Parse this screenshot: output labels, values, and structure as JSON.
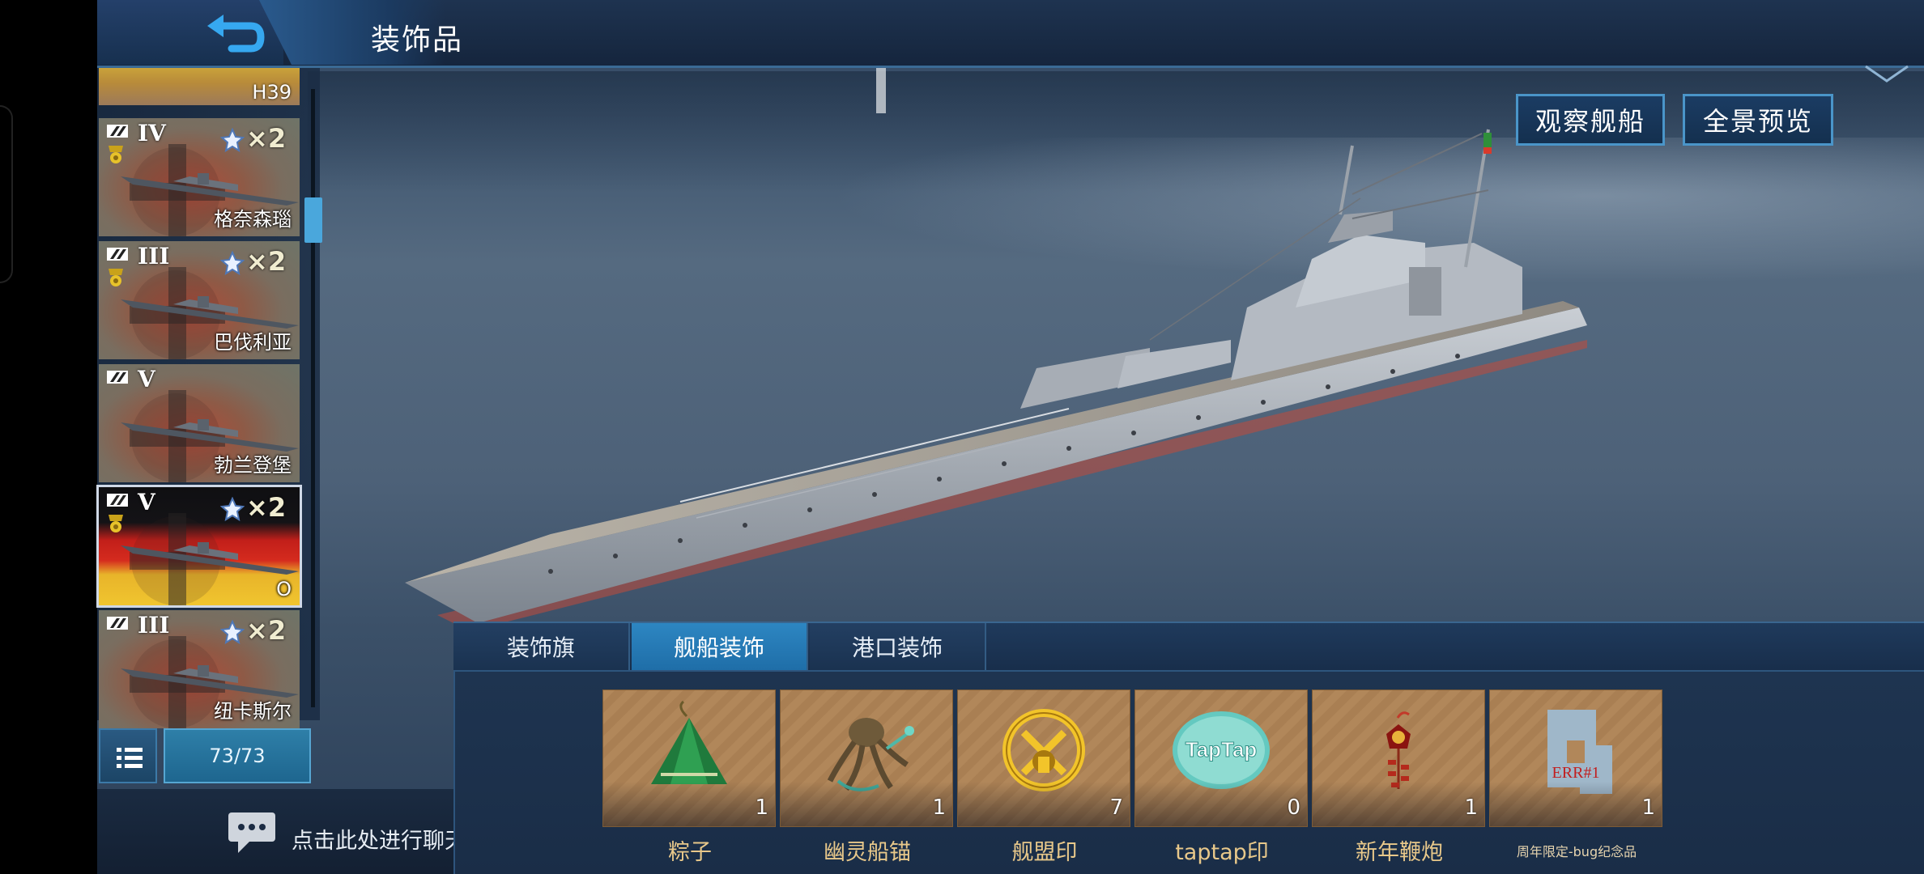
{
  "header": {
    "title": "装饰品",
    "back_icon": "back-arrow-icon"
  },
  "sidebar": {
    "partial_item": {
      "name": "H39"
    },
    "ships": [
      {
        "tier": "IV",
        "type": "battleship",
        "medal": true,
        "multiplier": "×2",
        "name": "格奈森瑙",
        "selected": false
      },
      {
        "tier": "III",
        "type": "battleship",
        "medal": true,
        "multiplier": "×2",
        "name": "巴伐利亚",
        "selected": false
      },
      {
        "tier": "V",
        "type": "battleship",
        "medal": false,
        "multiplier": "",
        "name": "勃兰登堡",
        "selected": false
      },
      {
        "tier": "V",
        "type": "battleship",
        "medal": true,
        "multiplier": "×2",
        "name": "O",
        "selected": true
      },
      {
        "tier": "III",
        "type": "battleship",
        "medal": false,
        "multiplier": "×2",
        "name": "纽卡斯尔",
        "selected": false
      }
    ],
    "count": "73/73"
  },
  "chat": {
    "prompt": "点击此处进行聊天"
  },
  "view_buttons": {
    "observe": "观察舰船",
    "panorama": "全景预览"
  },
  "tabs": [
    {
      "label": "装饰旗",
      "active": false
    },
    {
      "label": "舰船装饰",
      "active": true
    },
    {
      "label": "港口装饰",
      "active": false
    }
  ],
  "items": [
    {
      "label": "粽子",
      "qty": "1",
      "icon": "zongzi-icon"
    },
    {
      "label": "幽灵船锚",
      "qty": "1",
      "icon": "ghost-anchor-icon"
    },
    {
      "label": "舰盟印",
      "qty": "7",
      "icon": "fleet-seal-icon"
    },
    {
      "label": "taptap印",
      "qty": "0",
      "icon": "taptap-seal-icon",
      "icon_text": "TapTap"
    },
    {
      "label": "新年鞭炮",
      "qty": "1",
      "icon": "firecracker-icon"
    },
    {
      "label": "周年限定-bug纪念品",
      "qty": "1",
      "icon": "bug-souvenir-icon",
      "icon_text": "ERR#1"
    }
  ],
  "colors": {
    "accent": "#2d86c2",
    "item_label": "#e8c88a",
    "panel": "#1a2d47"
  }
}
